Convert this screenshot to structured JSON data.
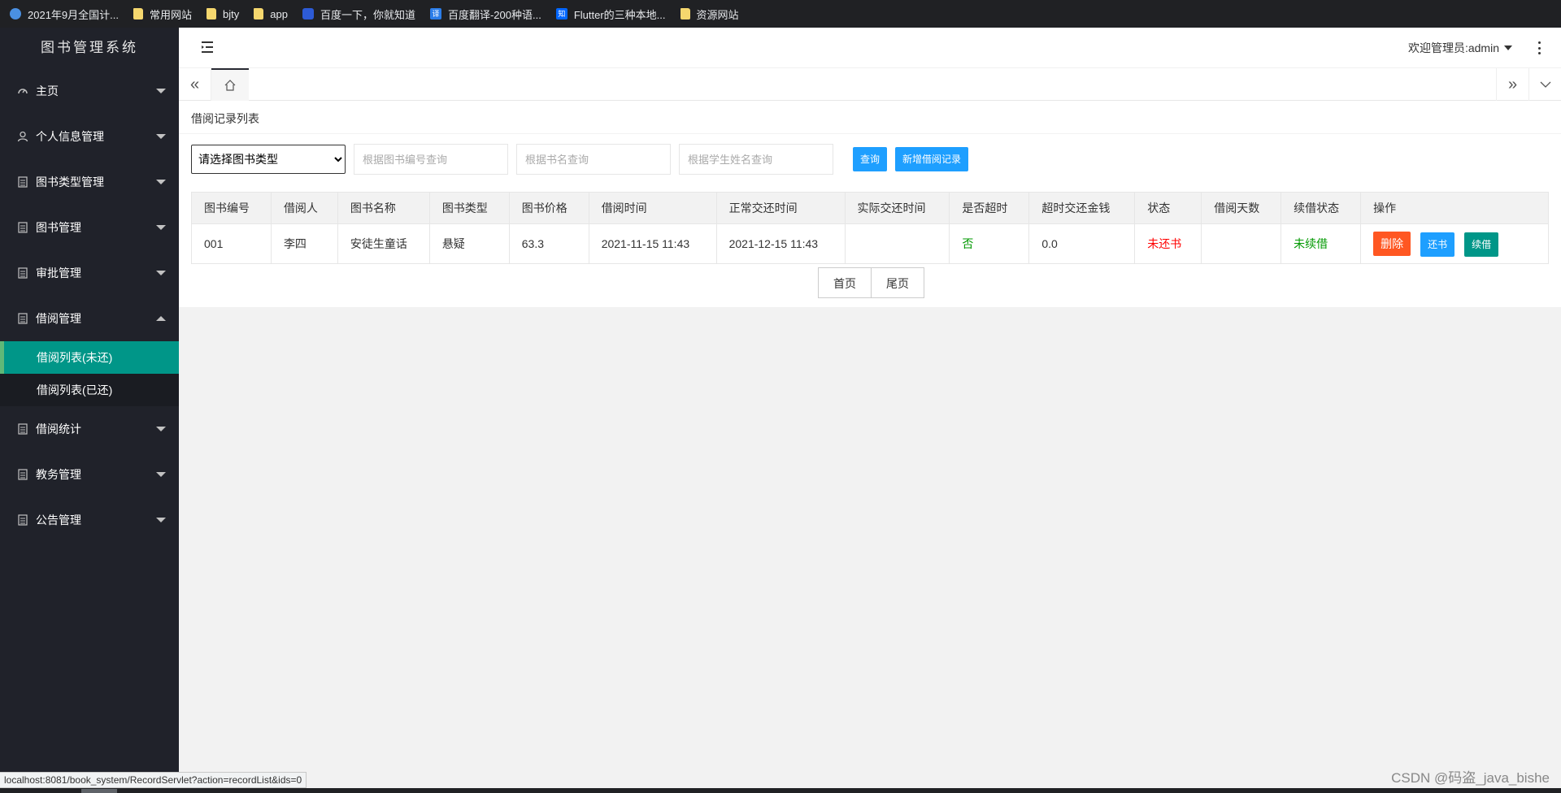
{
  "bookmarks": [
    {
      "label": "2021年9月全国计...",
      "icon": "globe-icon"
    },
    {
      "label": "常用网站",
      "icon": "folder-icon"
    },
    {
      "label": "bjty",
      "icon": "folder-icon"
    },
    {
      "label": "app",
      "icon": "folder-icon"
    },
    {
      "label": "百度一下，你就知道",
      "icon": "baidu-icon"
    },
    {
      "label": "百度翻译-200种语...",
      "icon": "fanyi-icon",
      "glyph": "译"
    },
    {
      "label": "Flutter的三种本地...",
      "icon": "zhihu-icon",
      "glyph": "知"
    },
    {
      "label": "资源网站",
      "icon": "folder-icon"
    }
  ],
  "app": {
    "title": "图书管理系统"
  },
  "sidebar": {
    "items": [
      {
        "label": "主页",
        "icon": "dashboard-icon"
      },
      {
        "label": "个人信息管理",
        "icon": "user-icon"
      },
      {
        "label": "图书类型管理",
        "icon": "doc-icon"
      },
      {
        "label": "图书管理",
        "icon": "doc-icon"
      },
      {
        "label": "审批管理",
        "icon": "doc-icon"
      },
      {
        "label": "借阅管理",
        "icon": "doc-icon",
        "expanded": true,
        "children": [
          {
            "label": "借阅列表(未还)",
            "active": true
          },
          {
            "label": "借阅列表(已还)",
            "active": false
          }
        ]
      },
      {
        "label": "借阅统计",
        "icon": "doc-icon"
      },
      {
        "label": "教务管理",
        "icon": "doc-icon"
      },
      {
        "label": "公告管理",
        "icon": "doc-icon"
      }
    ]
  },
  "header": {
    "welcome": "欢迎管理员:admin"
  },
  "page": {
    "breadcrumb": "借阅记录列表",
    "filters": {
      "type_select": "请选择图书类型",
      "book_id_placeholder": "根据图书编号查询",
      "book_name_placeholder": "根据书名查询",
      "student_placeholder": "根据学生姓名查询",
      "query_label": "查询",
      "add_label": "新增借阅记录"
    },
    "table": {
      "headers": [
        "图书编号",
        "借阅人",
        "图书名称",
        "图书类型",
        "图书价格",
        "借阅时间",
        "正常交还时间",
        "实际交还时间",
        "是否超时",
        "超时交还金钱",
        "状态",
        "借阅天数",
        "续借状态",
        "操作"
      ],
      "rows": [
        {
          "book_id": "001",
          "borrower": "李四",
          "book_name": "安徒生童话",
          "book_type": "悬疑",
          "price": "63.3",
          "borrow_time": "2021-11-15 11:43",
          "due_time": "2021-12-15 11:43",
          "return_time": "",
          "overdue": "否",
          "fine": "0.0",
          "status": "未还书",
          "days": "",
          "renew_status": "未续借",
          "actions": {
            "delete": "删除",
            "return": "还书",
            "renew": "续借"
          }
        }
      ]
    },
    "pager": {
      "first": "首页",
      "last": "尾页"
    }
  },
  "status_url": "localhost:8081/book_system/RecordServlet?action=recordList&ids=0",
  "watermark": "CSDN @码盗_java_bishe",
  "colors": {
    "sidebar_bg": "#20222a",
    "active_menu": "#009688",
    "primary_blue": "#1e9fff",
    "danger_orange": "#ff5722",
    "green_text": "#009900",
    "red_text": "#ff0000"
  }
}
